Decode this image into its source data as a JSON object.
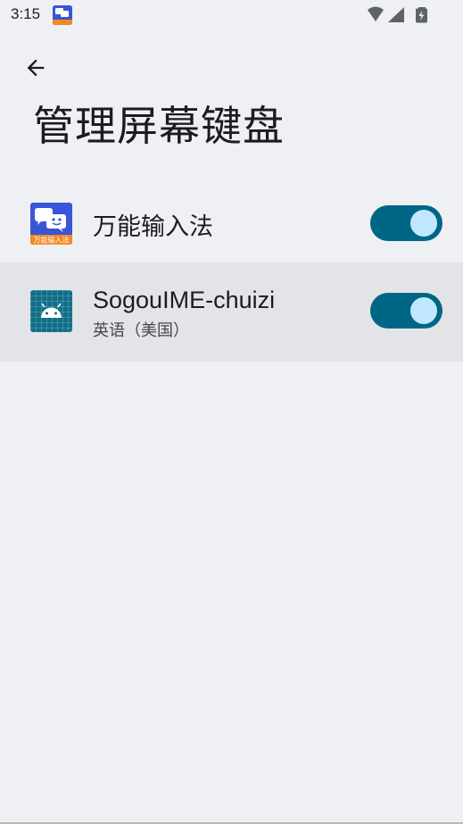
{
  "status_bar": {
    "time": "3:15",
    "icons": [
      "wanneng-app-icon",
      "wifi-icon",
      "signal-icon",
      "battery-charging-icon"
    ]
  },
  "header": {
    "back_icon": "arrow-back-icon",
    "title": "管理屏幕键盘"
  },
  "keyboards": [
    {
      "name": "万能输入法",
      "icon": "wanneng-keyboard-icon",
      "icon_caption": "万能输入法",
      "enabled": true
    },
    {
      "name": "SogouIME-chuizi",
      "subtitle": "英语（美国）",
      "icon": "android-icon",
      "enabled": true
    }
  ],
  "colors": {
    "background": "#eff0f3",
    "toggle_track": "#006685",
    "toggle_thumb": "#bfe8ff",
    "highlight_row": "#e3e4e7",
    "wanneng_blue": "#3a55d8",
    "wanneng_orange": "#f28a1e"
  }
}
